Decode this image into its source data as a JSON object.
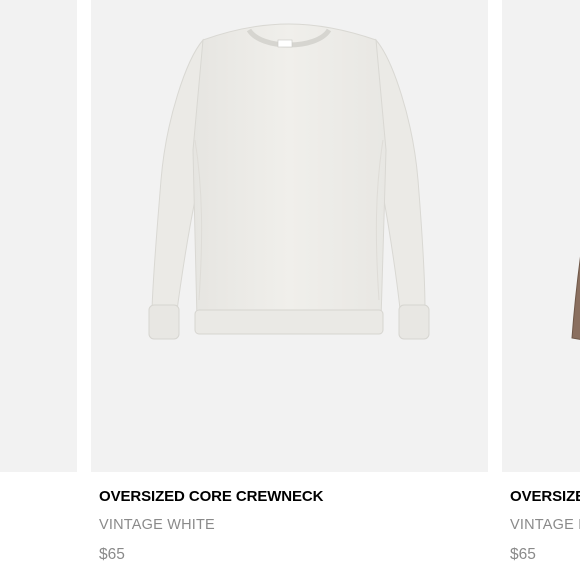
{
  "products": [
    {
      "title": "",
      "color": "",
      "price": ""
    },
    {
      "title": "OVERSIZED CORE CREWNECK",
      "color": "VINTAGE WHITE",
      "price": "$65",
      "swatch_hex": "#efeeea"
    },
    {
      "title": "OVERSIZE",
      "color": "VINTAGE B",
      "price": "$65",
      "swatch_hex": "#8a6f5f"
    }
  ],
  "colors": {
    "image_bg": "#f2f2f2",
    "title": "#000000",
    "muted": "#8a8a8a"
  }
}
